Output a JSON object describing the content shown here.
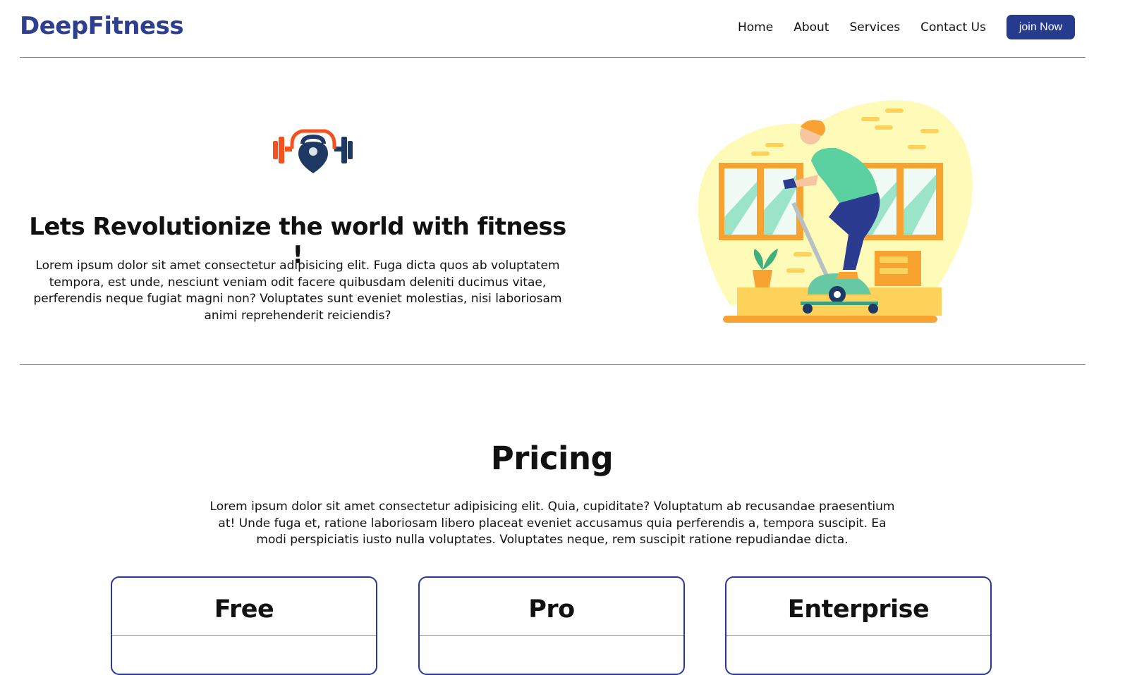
{
  "header": {
    "brand": "DeepFitness",
    "nav": [
      "Home",
      "About",
      "Services",
      "Contact Us"
    ],
    "cta_label": "join Now"
  },
  "hero": {
    "logo_icon": "kettlebell-barbell-icon",
    "title": "Lets Revolutionize the world with fitness !",
    "text": "Lorem ipsum dolor sit amet consectetur adipisicing elit. Fuga dicta quos ab voluptatem tempora, est unde, nesciunt veniam odit facere quibusdam deleniti ducimus vitae, perferendis neque fugiat magni non? Voluptates sunt eveniet molestias, nisi laboriosam animi reprehenderit reiciendis?",
    "illustration_icon": "exercise-bike-illustration"
  },
  "pricing": {
    "title": "Pricing",
    "text": "Lorem ipsum dolor sit amet consectetur adipisicing elit. Quia, cupiditate? Voluptatum ab recusandae praesentium at! Unde fuga et, ratione laboriosam libero placeat eveniet accusamus quia perferendis a, tempora suscipit. Ea modi perspiciatis iusto nulla voluptates. Voluptates neque, rem suscipit ratione repudiandae dicta.",
    "plans": [
      "Free",
      "Pro",
      "Enterprise"
    ]
  },
  "colors": {
    "brand": "#2f3f8f",
    "cta_background": "#263b8e",
    "card_border": "#27379a",
    "logo_orange": "#f4511e",
    "logo_navy": "#1e3a64"
  }
}
